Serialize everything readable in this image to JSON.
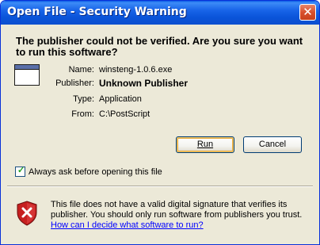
{
  "window": {
    "title": "Open File - Security Warning",
    "close_symbol": "✕"
  },
  "dialog": {
    "header": "The publisher could not be verified.  Are you sure you want to run this software?",
    "fields": [
      {
        "label": "Name:",
        "value": "winsteng-1.0.6.exe"
      },
      {
        "label": "Publisher:",
        "value": "Unknown Publisher"
      },
      {
        "label": "Type:",
        "value": "Application"
      },
      {
        "label": "From:",
        "value": "C:\\PostScript"
      }
    ],
    "buttons": {
      "run_label": "Run",
      "cancel_label": "Cancel"
    },
    "checkbox": {
      "label": "Always ask before opening this file",
      "checked": true
    },
    "warning": {
      "text": "This file does not have a valid digital signature that verifies its publisher.  You should only run software from publishers you trust.",
      "link": "How can I decide what software to run?"
    }
  },
  "colors": {
    "titlebar": "#0a54d9",
    "dialog_background": "#ece9d8",
    "close_button": "#d9502d",
    "link": "#0000ff",
    "shield": "#c62020"
  },
  "icons": {
    "app": "application-window-icon",
    "warning": "security-shield-icon"
  }
}
